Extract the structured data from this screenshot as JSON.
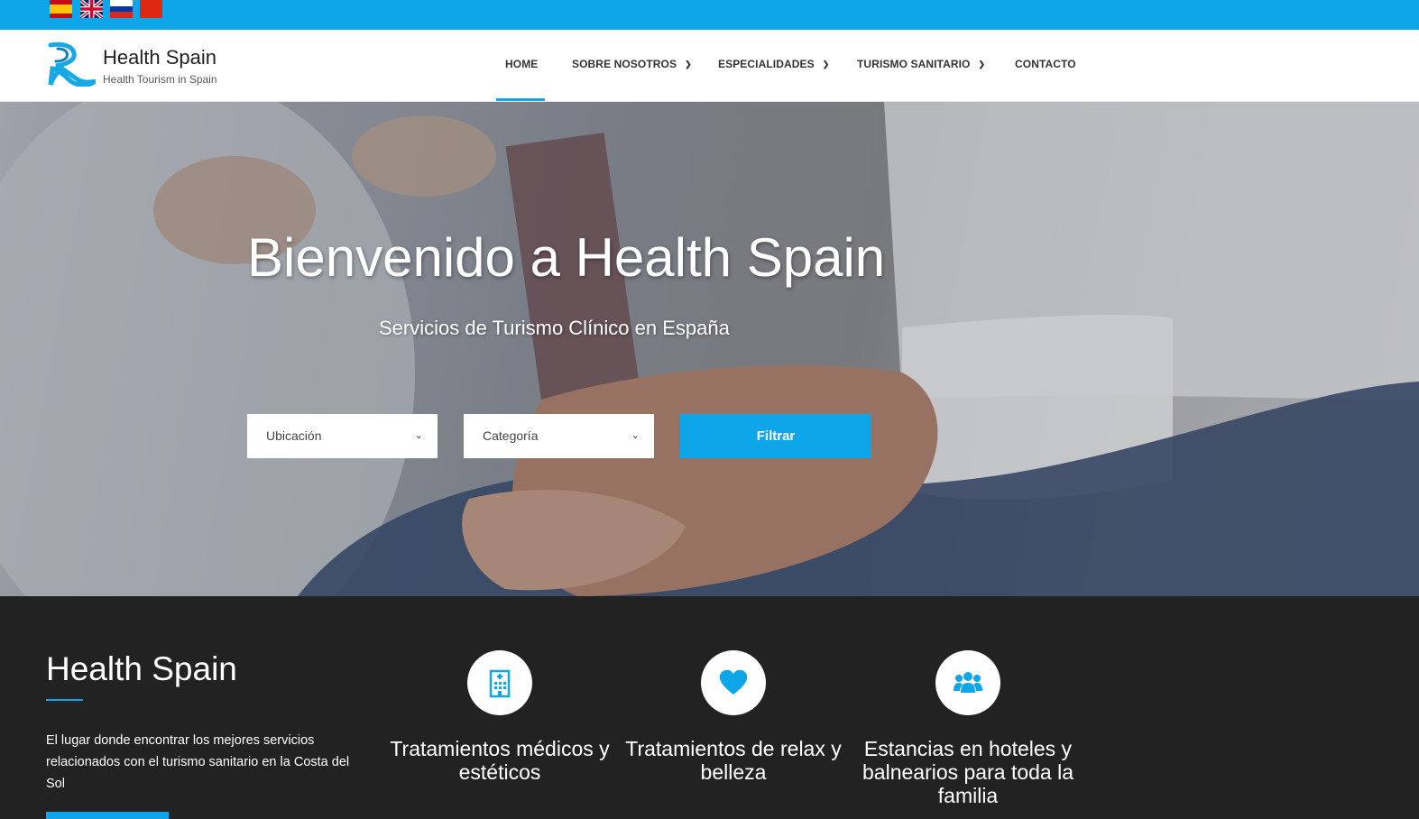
{
  "topbar": {
    "flags": [
      {
        "name": "spanish-flag",
        "label": "Español"
      },
      {
        "name": "english-flag",
        "label": "English"
      },
      {
        "name": "russian-flag",
        "label": "Русский"
      },
      {
        "name": "chinese-flag",
        "label": "中文"
      }
    ],
    "color": "#0ea6e8"
  },
  "header": {
    "brand_name": "Health Spain",
    "brand_tagline": "Health Tourism in Spain",
    "nav": [
      {
        "label": "HOME",
        "active": true,
        "has_dropdown": false
      },
      {
        "label": "SOBRE NOSOTROS",
        "active": false,
        "has_dropdown": true
      },
      {
        "label": "ESPECIALIDADES",
        "active": false,
        "has_dropdown": true
      },
      {
        "label": "TURISMO SANITARIO",
        "active": false,
        "has_dropdown": true
      },
      {
        "label": "CONTACTO",
        "active": false,
        "has_dropdown": false
      }
    ]
  },
  "hero": {
    "title": "Bienvenido a Health Spain",
    "subtitle": "Servicios de Turismo Clínico en España",
    "location_select": "Ubicación",
    "category_select": "Categoría",
    "filter_button": "Filtrar"
  },
  "about": {
    "title": "Health Spain",
    "description": "El lugar donde encontrar los mejores servicios relacionados con el turismo sanitario en la Costa del Sol"
  },
  "features": [
    {
      "icon": "hospital-icon",
      "text": "Tratamientos médicos y estéticos"
    },
    {
      "icon": "heart-icon",
      "text": "Tratamientos de relax y belleza"
    },
    {
      "icon": "group-icon",
      "text": "Estancias en hoteles y balnearios para toda la familia"
    }
  ],
  "colors": {
    "accent": "#0ea6e8",
    "dark_bg": "#222222"
  }
}
